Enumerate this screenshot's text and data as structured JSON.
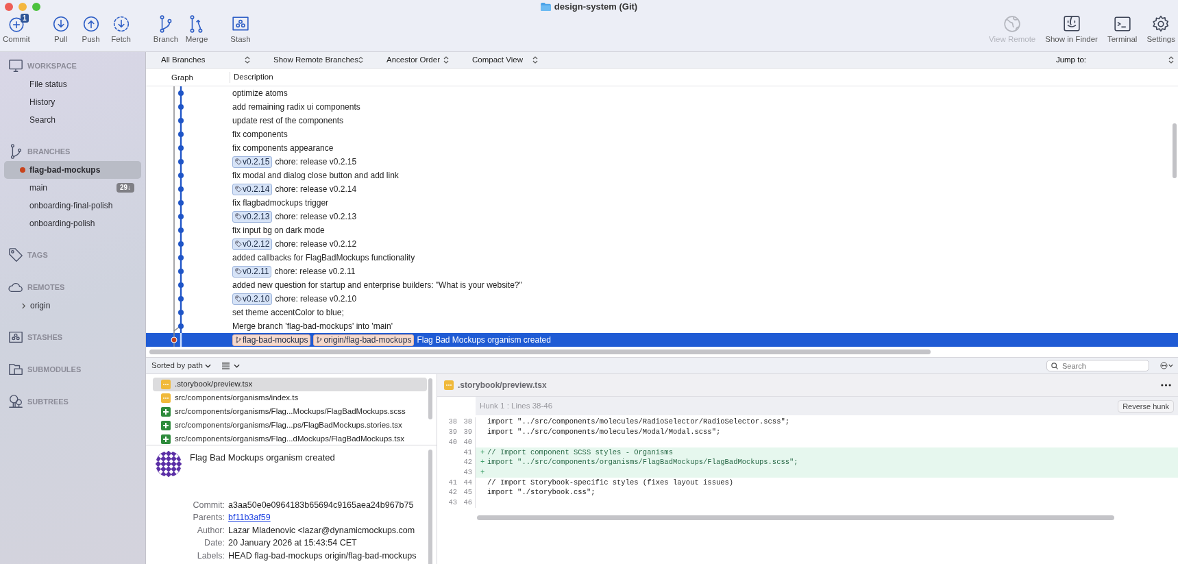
{
  "window": {
    "title": "design-system (Git)"
  },
  "toolbar": {
    "left_groups": [
      [
        {
          "label": "Commit",
          "badge": "1",
          "disabled": false
        }
      ],
      [
        {
          "label": "Pull",
          "disabled": false
        },
        {
          "label": "Push",
          "disabled": false
        },
        {
          "label": "Fetch",
          "disabled": false
        }
      ],
      [
        {
          "label": "Branch",
          "disabled": false
        },
        {
          "label": "Merge",
          "disabled": false
        }
      ],
      [
        {
          "label": "Stash",
          "disabled": false
        }
      ]
    ],
    "right": [
      {
        "label": "View Remote",
        "disabled": true
      },
      {
        "label": "Show in Finder",
        "disabled": false
      },
      {
        "label": "Terminal",
        "disabled": false
      },
      {
        "label": "Settings",
        "disabled": false
      }
    ]
  },
  "sidebar": {
    "sections": [
      {
        "title": "WORKSPACE",
        "items": [
          {
            "kind": "nav",
            "label": "File status"
          },
          {
            "kind": "nav",
            "label": "History"
          },
          {
            "kind": "nav",
            "label": "Search"
          }
        ]
      },
      {
        "title": "BRANCHES",
        "items": [
          {
            "kind": "branch",
            "label": "flag-bad-mockups",
            "selected": true,
            "current": true
          },
          {
            "kind": "branch",
            "label": "main",
            "selected": false,
            "current": false,
            "badge": "29↓"
          },
          {
            "kind": "branch",
            "label": "onboarding-final-polish",
            "selected": false,
            "current": false
          },
          {
            "kind": "branch",
            "label": "onboarding-polish",
            "selected": false,
            "current": false
          }
        ]
      },
      {
        "title": "TAGS"
      },
      {
        "title": "REMOTES",
        "items": [
          {
            "kind": "remote",
            "label": "origin",
            "expanded": false
          }
        ]
      },
      {
        "title": "STASHES"
      },
      {
        "title": "SUBMODULES"
      },
      {
        "title": "SUBTREES"
      }
    ]
  },
  "filters": [
    {
      "label": "All Branches"
    },
    {
      "label": "Show Remote Branches"
    },
    {
      "label": "Ancestor Order"
    },
    {
      "label": "Compact View"
    }
  ],
  "jump_to": {
    "label": "Jump to:"
  },
  "history": {
    "columns": [
      "Graph",
      "Description"
    ],
    "rows": [
      {
        "message": "optimize atoms",
        "selected": false,
        "current": false
      },
      {
        "message": "add remaining radix ui components",
        "selected": false,
        "current": false
      },
      {
        "message": "update rest of the components",
        "selected": false,
        "current": false
      },
      {
        "message": "fix components",
        "selected": false,
        "current": false
      },
      {
        "message": "fix components appearance",
        "selected": false,
        "current": false
      },
      {
        "message": "chore: release v0.2.15",
        "selected": false,
        "current": false,
        "refs": [
          {
            "kind": "tag",
            "label": "v0.2.15"
          }
        ]
      },
      {
        "message": "fix modal and dialog close button and add link",
        "selected": false,
        "current": false
      },
      {
        "message": "chore: release v0.2.14",
        "selected": false,
        "current": false,
        "refs": [
          {
            "kind": "tag",
            "label": "v0.2.14"
          }
        ]
      },
      {
        "message": "fix flagbadmockups trigger",
        "selected": false,
        "current": false
      },
      {
        "message": "chore: release v0.2.13",
        "selected": false,
        "current": false,
        "refs": [
          {
            "kind": "tag",
            "label": "v0.2.13"
          }
        ]
      },
      {
        "message": "fix input bg on dark mode",
        "selected": false,
        "current": false
      },
      {
        "message": "chore: release v0.2.12",
        "selected": false,
        "current": false,
        "refs": [
          {
            "kind": "tag",
            "label": "v0.2.12"
          }
        ]
      },
      {
        "message": "added callbacks for FlagBadMockups functionality",
        "selected": false,
        "current": false
      },
      {
        "message": "chore: release v0.2.11",
        "selected": false,
        "current": false,
        "refs": [
          {
            "kind": "tag",
            "label": "v0.2.11"
          }
        ]
      },
      {
        "message": "added new question for startup and enterprise builders: \"What is your website?\"",
        "selected": false,
        "current": false
      },
      {
        "message": "chore: release v0.2.10",
        "selected": false,
        "current": false,
        "refs": [
          {
            "kind": "tag",
            "label": "v0.2.10"
          }
        ]
      },
      {
        "message": "set theme accentColor to blue;",
        "selected": false,
        "current": false
      },
      {
        "message": "Merge branch 'flag-bad-mockups' into 'main'",
        "selected": false,
        "current": false,
        "merge": true
      },
      {
        "message": "Flag Bad Mockups organism created",
        "selected": true,
        "current": true,
        "refs": [
          {
            "kind": "branch",
            "label": "flag-bad-mockups"
          },
          {
            "kind": "branch",
            "label": "origin/flag-bad-mockups"
          }
        ]
      }
    ]
  },
  "files": {
    "sort": "Sorted by path",
    "items": [
      {
        "path": ".storybook/preview.tsx",
        "kind": "modified",
        "selected": true
      },
      {
        "path": "src/components/organisms/index.ts",
        "kind": "modified",
        "selected": false
      },
      {
        "path": "src/components/organisms/Flag...Mockups/FlagBadMockups.scss",
        "kind": "added",
        "selected": false
      },
      {
        "path": "src/components/organisms/Flag...ps/FlagBadMockups.stories.tsx",
        "kind": "added",
        "selected": false
      },
      {
        "path": "src/components/organisms/Flag...dMockups/FlagBadMockups.tsx",
        "kind": "added",
        "selected": false
      }
    ]
  },
  "commit_details": {
    "subject": "Flag Bad Mockups organism created",
    "fields": [
      {
        "kind": "text",
        "label": "Commit:",
        "value": "a3aa50e0e0964183b65694c9165aea24b967b75"
      },
      {
        "kind": "link",
        "label": "Parents:",
        "value": "bf11b3af59"
      },
      {
        "kind": "text",
        "label": "Author:",
        "value": "Lazar Mladenovic <lazar@dynamicmockups.com"
      },
      {
        "kind": "text",
        "label": "Date:",
        "value": "20 January 2026 at 15:43:54 CET"
      },
      {
        "kind": "text",
        "label": "Labels:",
        "value": "HEAD flag-bad-mockups origin/flag-bad-mockups"
      }
    ]
  },
  "diff": {
    "search": {
      "placeholder": "Search"
    },
    "file": {
      "name": ".storybook/preview.tsx",
      "kind": "modified"
    },
    "hunk": {
      "title": "Hunk 1 : Lines 38-46",
      "button": "Reverse hunk",
      "lines": [
        {
          "kind": "context",
          "old": "38",
          "new": "38",
          "text": "import \"../src/components/molecules/RadioSelector/RadioSelector.scss\";"
        },
        {
          "kind": "context",
          "old": "39",
          "new": "39",
          "text": "import \"../src/components/molecules/Modal/Modal.scss\";"
        },
        {
          "kind": "context",
          "old": "40",
          "new": "40"
        },
        {
          "kind": "added",
          "new": "41",
          "marker": "+",
          "text": "// Import component SCSS styles - Organisms"
        },
        {
          "kind": "added",
          "new": "42",
          "marker": "+",
          "text": "import \"../src/components/organisms/FlagBadMockups/FlagBadMockups.scss\";"
        },
        {
          "kind": "added",
          "new": "43",
          "marker": "+"
        },
        {
          "kind": "context",
          "old": "41",
          "new": "44",
          "text": "// Import Storybook-specific styles (fixes layout issues)"
        },
        {
          "kind": "context",
          "old": "42",
          "new": "45",
          "text": "import \"./storybook.css\";"
        },
        {
          "kind": "context",
          "old": "43",
          "new": "46"
        }
      ]
    }
  }
}
